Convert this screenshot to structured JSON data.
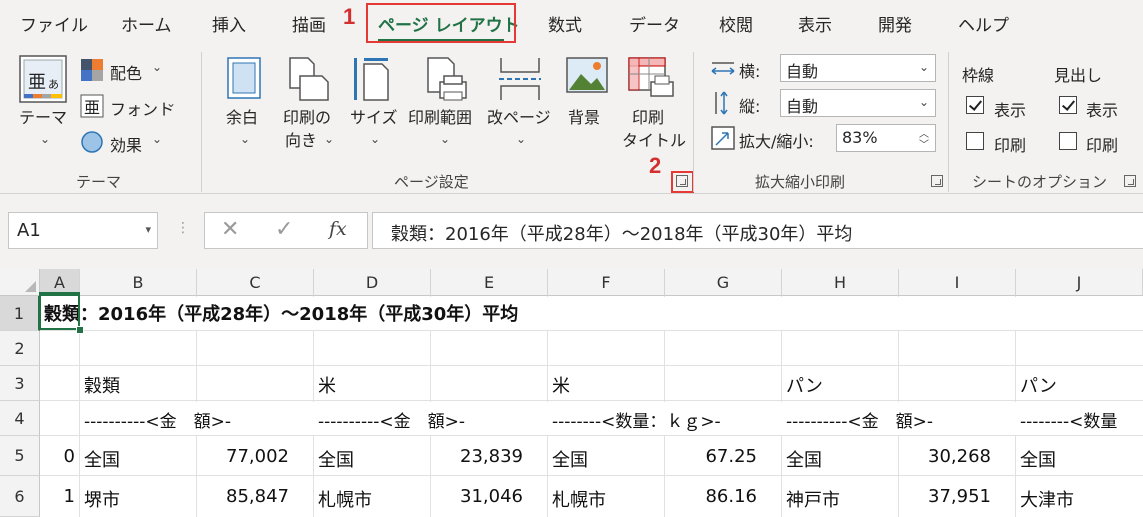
{
  "tabs": [
    "ファイル",
    "ホーム",
    "挿入",
    "描画",
    "ページ レイアウト",
    "数式",
    "データ",
    "校閲",
    "表示",
    "開発",
    "ヘルプ"
  ],
  "annotations": {
    "one": "1",
    "two": "2"
  },
  "ribbon": {
    "themes": {
      "theme_label": "テーマ",
      "colors_label": "配色",
      "fonts_label": "フォント",
      "effects_label": "効果",
      "group_label": "テーマ"
    },
    "page_setup": {
      "margins_label": "余白",
      "orientation_line1": "印刷の",
      "orientation_line2": "向き",
      "size_label": "サイズ",
      "print_area_label": "印刷範囲",
      "breaks_label": "改ページ",
      "background_label": "背景",
      "print_titles_line1": "印刷",
      "print_titles_line2": "タイトル",
      "group_label": "ページ設定"
    },
    "scale": {
      "width_label": "横:",
      "width_value": "自動",
      "height_label": "縦:",
      "height_value": "自動",
      "scale_label": "拡大/縮小:",
      "scale_value": "83%",
      "group_label": "拡大縮小印刷"
    },
    "sheet_options": {
      "gridlines_label": "枠線",
      "headings_label": "見出し",
      "view_label": "表示",
      "print_label": "印刷",
      "group_label": "シートのオプション",
      "gridlines_view": true,
      "gridlines_print": false,
      "headings_view": true,
      "headings_print": false
    }
  },
  "formula_bar": {
    "name_box": "A1",
    "fx_label": "fx",
    "formula": "穀類：2016年（平成28年）～2018年（平成30年）平均"
  },
  "columns": [
    "A",
    "B",
    "C",
    "D",
    "E",
    "F",
    "G",
    "H",
    "I",
    "J"
  ],
  "rows": [
    "1",
    "2",
    "3",
    "4",
    "5",
    "6"
  ],
  "cells": {
    "r1": {
      "a": "穀類：2016年（平成28年）～2018年（平成30年）平均"
    },
    "r3": {
      "b": "穀類",
      "d": "米",
      "f": "米",
      "h": "パン",
      "j": "パン"
    },
    "r4": {
      "b": "----------<金　額>-",
      "d": "----------<金　額>-",
      "f": "--------<数量：ｋｇ>-",
      "h": "----------<金　額>-",
      "j": "--------<数量"
    },
    "r5": {
      "a": "0",
      "b": "全国",
      "c": "77,002",
      "d": "全国",
      "e": "23,839",
      "f": "全国",
      "g": "67.25",
      "h": "全国",
      "i": "30,268",
      "j": "全国"
    },
    "r6": {
      "a": "1",
      "b": "堺市",
      "c": "85,847",
      "d": "札幌市",
      "e": "31,046",
      "f": "札幌市",
      "g": "86.16",
      "h": "神戸市",
      "i": "37,951",
      "j": "大津市"
    }
  }
}
